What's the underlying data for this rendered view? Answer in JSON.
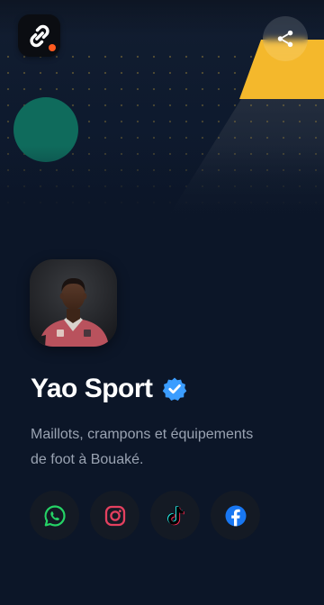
{
  "profile": {
    "name": "Yao Sport",
    "verified": true,
    "bio_line_1": "Maillots, crampons et équipements",
    "bio_line_2": "de foot à Bouaké."
  },
  "header": {
    "logo_icon": "link-logo-icon",
    "share_icon": "share-icon"
  },
  "social_links": [
    {
      "network": "WhatsApp",
      "icon": "whatsapp-icon",
      "color": "#25d366"
    },
    {
      "network": "Instagram",
      "icon": "instagram-icon",
      "color": "#e4405f"
    },
    {
      "network": "TikTok",
      "icon": "tiktok-icon",
      "color": "#000000"
    },
    {
      "network": "Facebook",
      "icon": "facebook-icon",
      "color": "#1877f2"
    }
  ],
  "colors": {
    "background": "#0c1628",
    "accent_yellow": "#f4b82c",
    "accent_teal": "#0f6b5c",
    "verified_blue": "#3b9dff",
    "logo_dot": "#ff5a1f"
  }
}
